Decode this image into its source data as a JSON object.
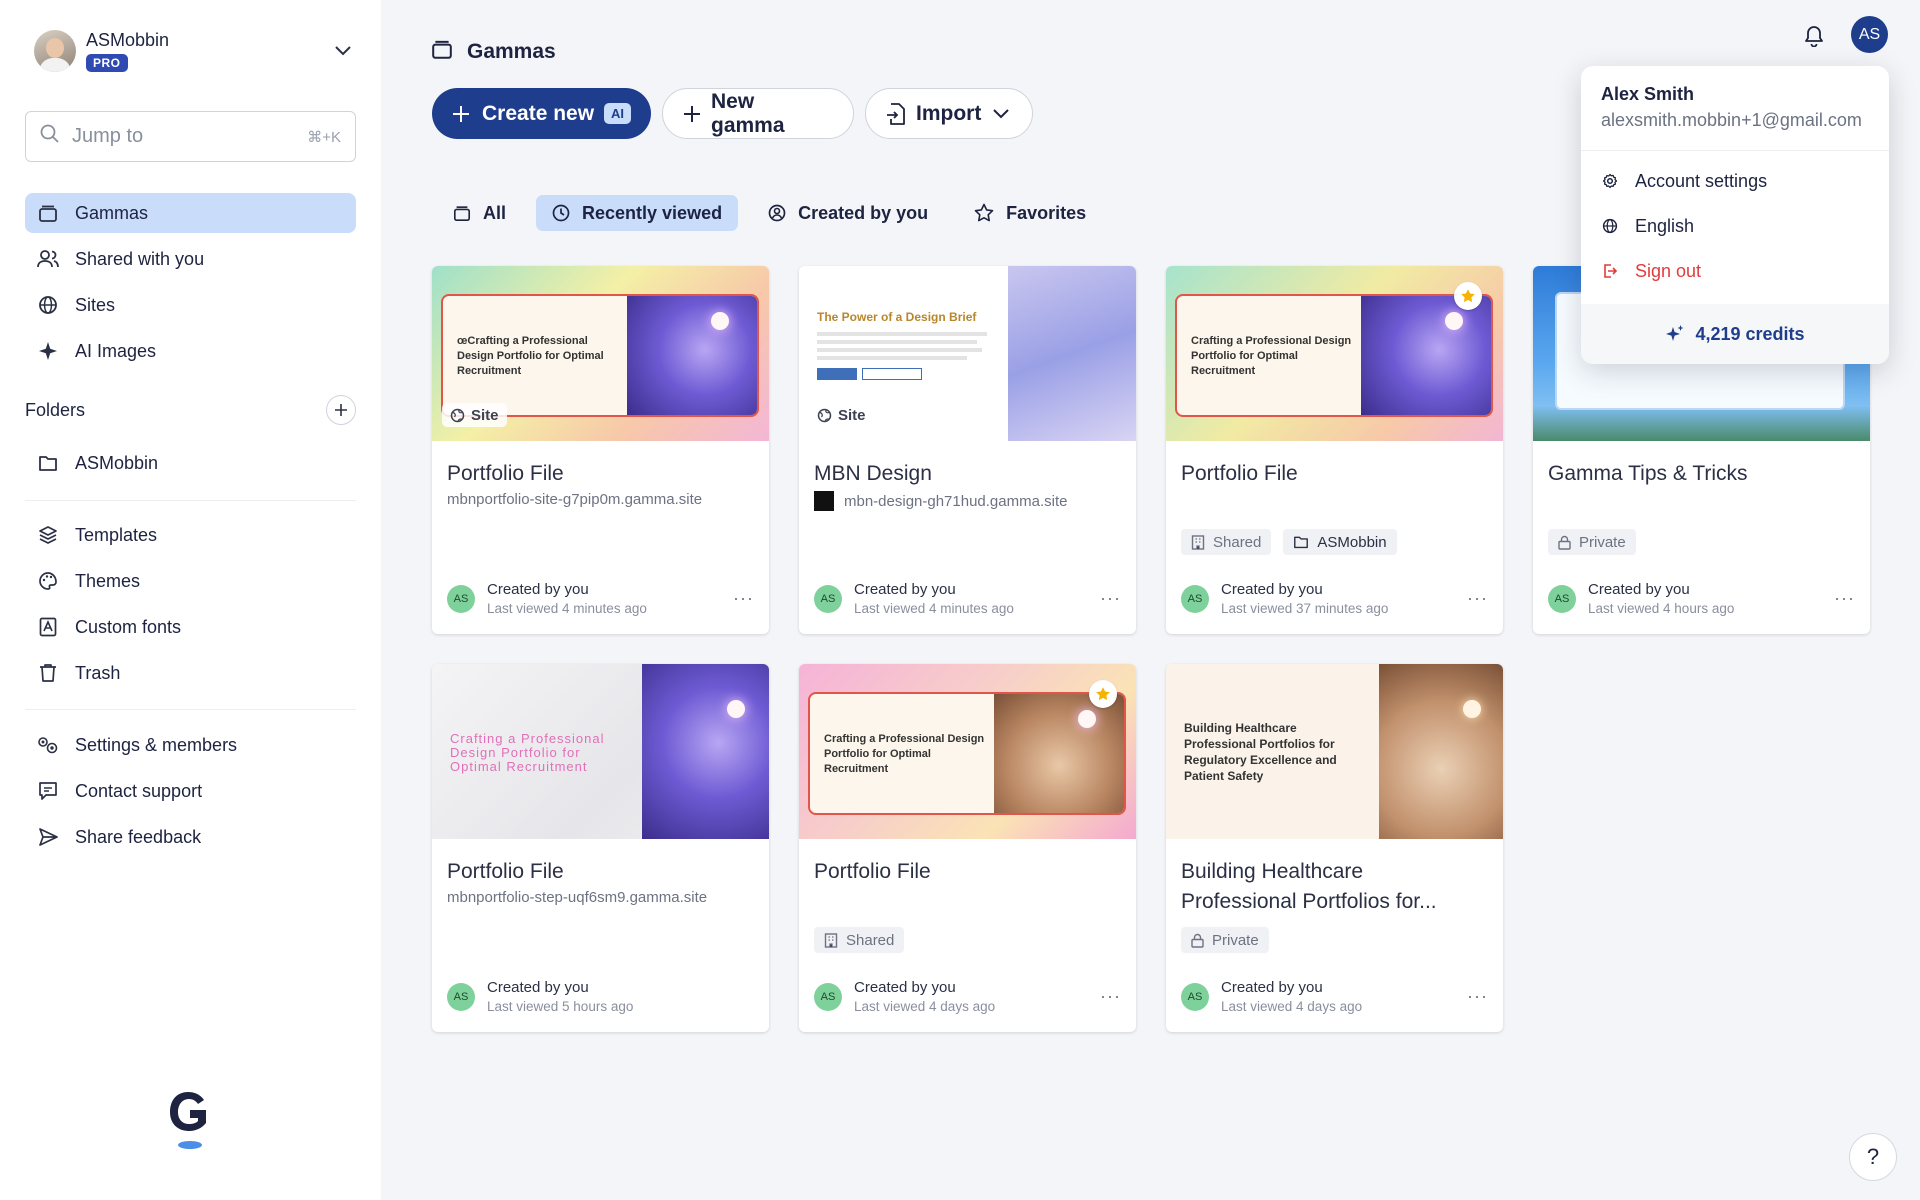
{
  "workspace": {
    "name": "ASMobbin",
    "badge": "PRO"
  },
  "jump": {
    "placeholder": "Jump to",
    "shortcut": "⌘+K"
  },
  "sidebar": {
    "primary": [
      {
        "label": "Gammas",
        "icon": "stack-icon",
        "active": true
      },
      {
        "label": "Shared with you",
        "icon": "users-icon"
      },
      {
        "label": "Sites",
        "icon": "globe-icon"
      },
      {
        "label": "AI Images",
        "icon": "sparkle-icon"
      }
    ],
    "folders_title": "Folders",
    "folders": [
      {
        "label": "ASMobbin",
        "icon": "folder-icon"
      }
    ],
    "tools": [
      {
        "label": "Templates",
        "icon": "layers-icon"
      },
      {
        "label": "Themes",
        "icon": "palette-icon"
      },
      {
        "label": "Custom fonts",
        "icon": "font-icon"
      },
      {
        "label": "Trash",
        "icon": "trash-icon"
      }
    ],
    "footer": [
      {
        "label": "Settings & members",
        "icon": "settings-icon"
      },
      {
        "label": "Contact support",
        "icon": "chat-icon"
      },
      {
        "label": "Share feedback",
        "icon": "send-icon"
      }
    ]
  },
  "main": {
    "title": "Gammas",
    "create_new": "Create new",
    "ai_badge": "AI",
    "new_gamma": "New gamma",
    "import": "Import",
    "tabs": [
      {
        "label": "All",
        "icon": "stack-icon"
      },
      {
        "label": "Recently viewed",
        "icon": "clock-icon",
        "active": true
      },
      {
        "label": "Created by you",
        "icon": "user-circle-icon"
      },
      {
        "label": "Favorites",
        "icon": "star-icon"
      }
    ]
  },
  "cards": [
    {
      "title": "Portfolio File",
      "subtitle": "mbnportfolio-site-g7pip0m.gamma.site",
      "thumb_text": "œCrafting a Professional Design Portfolio for Optimal Recruitment",
      "chip": "Site",
      "created": "Created by you",
      "viewed": "Last viewed 4 minutes ago"
    },
    {
      "title": "MBN Design",
      "subtitle": "mbn-design-gh71hud.gamma.site",
      "thumb_text": "The Power of a Design Brief",
      "chip": "Site",
      "created": "Created by you",
      "viewed": "Last viewed 4 minutes ago"
    },
    {
      "title": "Portfolio File",
      "thumb_text": "Crafting a Professional Design Portfolio for Optimal Recruitment",
      "tags": [
        "Shared",
        "ASMobbin"
      ],
      "created": "Created by you",
      "viewed": "Last viewed 37 minutes ago"
    },
    {
      "title": "Gamma Tips & Tricks",
      "tags": [
        "Private"
      ],
      "created": "Created by you",
      "viewed": "Last viewed 4 hours ago"
    },
    {
      "title": "Portfolio File",
      "subtitle": "mbnportfolio-step-uqf6sm9.gamma.site",
      "thumb_text": "Crafting a Professional Design Portfolio for Optimal Recruitment",
      "created": "Created by you",
      "viewed": "Last viewed 5 hours ago"
    },
    {
      "title": "Portfolio File",
      "thumb_text": "Crafting a Professional Design Portfolio for Optimal Recruitment",
      "tags": [
        "Shared"
      ],
      "created": "Created by you",
      "viewed": "Last viewed 4 days ago"
    },
    {
      "title": "Building Healthcare Professional Portfolios for...",
      "thumb_text": "Building Healthcare Professional Portfolios for Regulatory Excellence and Patient Safety",
      "tags": [
        "Private"
      ],
      "created": "Created by you",
      "viewed": "Last viewed 4 days ago"
    }
  ],
  "avatar_initials": "AS",
  "user_menu": {
    "name": "Alex Smith",
    "email": "alexsmith.mobbin+1@gmail.com",
    "items": [
      "Account settings",
      "English",
      "Sign out"
    ],
    "credits": "4,219 credits"
  },
  "help": "?"
}
